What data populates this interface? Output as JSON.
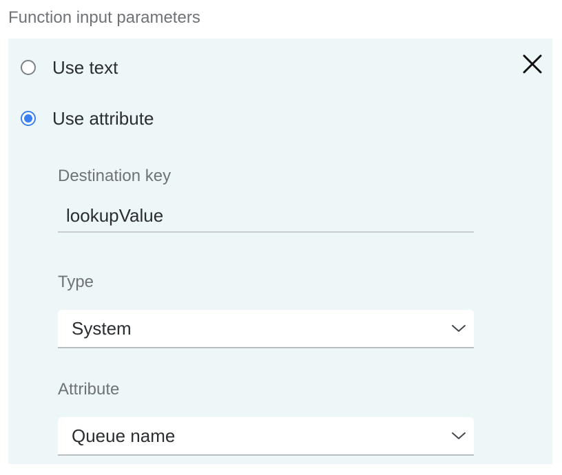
{
  "section": {
    "label": "Function input parameters"
  },
  "options": {
    "use_text_label": "Use text",
    "use_attribute_label": "Use attribute",
    "selected": "use_attribute"
  },
  "fields": {
    "destination_key": {
      "label": "Destination key",
      "value": "lookupValue"
    },
    "type": {
      "label": "Type",
      "selected": "System"
    },
    "attribute": {
      "label": "Attribute",
      "selected": "Queue name"
    }
  },
  "icons": {
    "close": "close-icon",
    "dropdown": "chevron-down-icon"
  },
  "colors": {
    "panel_bg": "#edf7f8",
    "radio_selected": "#3b7ff0",
    "label_gray": "#6f7377",
    "text_dark": "#2b2e31"
  }
}
